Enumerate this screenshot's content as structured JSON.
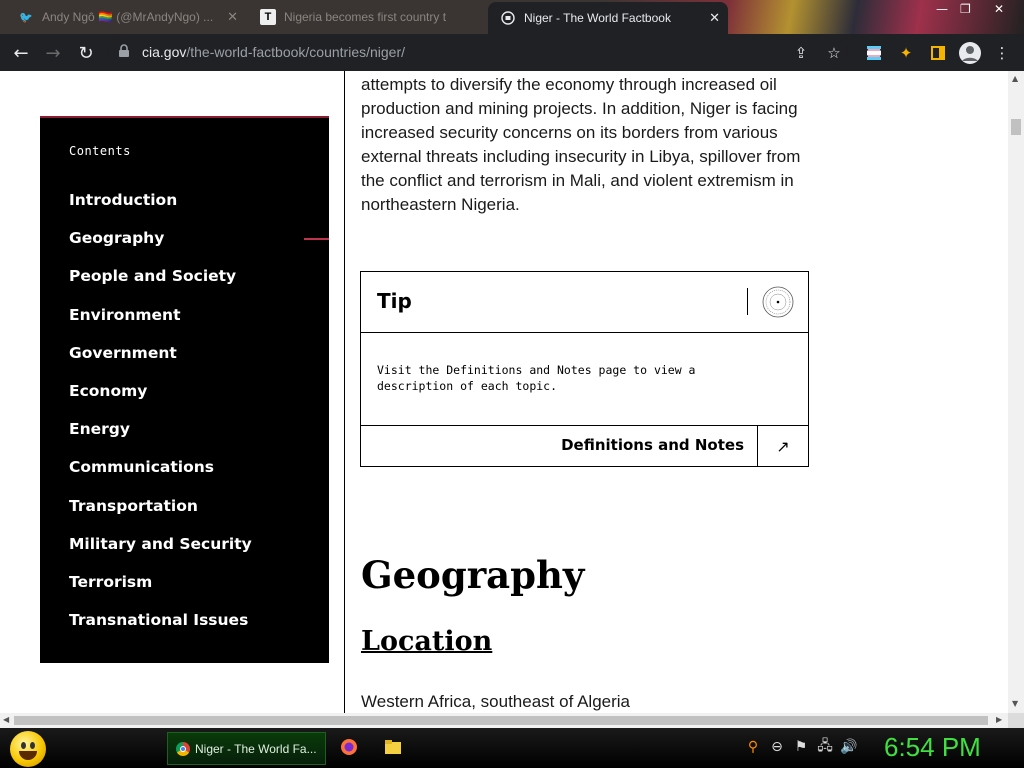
{
  "browser": {
    "tabs": [
      {
        "title": "Andy Ngô 🏳️‍🌈 (@MrAndyNgo) ...",
        "favicon": "twitter-icon",
        "active": false
      },
      {
        "title": "Nigeria becomes first country t",
        "favicon": "T",
        "active": false
      },
      {
        "title": "Niger - The World Factbook",
        "favicon": "cia-icon",
        "active": true
      }
    ],
    "url_domain": "cia.gov",
    "url_path": "/the-world-factbook/countries/niger/"
  },
  "sidebar": {
    "heading": "Contents",
    "items": [
      {
        "label": "Introduction"
      },
      {
        "label": "Geography"
      },
      {
        "label": "People and Society"
      },
      {
        "label": "Environment"
      },
      {
        "label": "Government"
      },
      {
        "label": "Economy"
      },
      {
        "label": "Energy"
      },
      {
        "label": "Communications"
      },
      {
        "label": "Transportation"
      },
      {
        "label": "Military and Security"
      },
      {
        "label": "Terrorism"
      },
      {
        "label": "Transnational Issues"
      }
    ],
    "active_item": "Geography"
  },
  "main": {
    "intro_text": "attempts to diversify the economy through increased oil production and mining projects. In addition, Niger is facing increased security concerns on its borders from various external threats including insecurity in Libya, spillover from the conflict and terrorism in Mali, and violent extremism in northeastern Nigeria.",
    "tip": {
      "title": "Tip",
      "body": "Visit the Definitions and Notes page to view a description of each topic.",
      "link_label": "Definitions and Notes"
    },
    "section_heading": "Geography",
    "subsection_heading": "Location",
    "location_text": "Western Africa, southeast of Algeria"
  },
  "taskbar": {
    "window_label": "Niger - The World Fa...",
    "clock": "6:54 PM"
  },
  "colors": {
    "sidebar_bg": "#000000",
    "accent": "#c0334d",
    "clock": "#40e040"
  }
}
